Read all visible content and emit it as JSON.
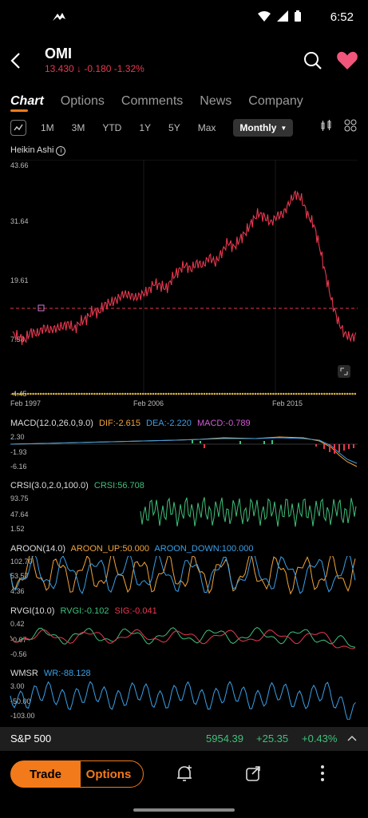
{
  "status": {
    "time": "6:52"
  },
  "header": {
    "ticker": "OMI",
    "price": "13.430",
    "change": "-0.180",
    "change_pct": "-1.32%"
  },
  "tabs": [
    "Chart",
    "Options",
    "Comments",
    "News",
    "Company"
  ],
  "ranges": [
    "1M",
    "3M",
    "YTD",
    "1Y",
    "5Y",
    "Max"
  ],
  "selected_range": "Monthly",
  "main_chart": {
    "type_label": "Heikin Ashi",
    "y_ticks": [
      "43.66",
      "31.64",
      "19.61",
      "7.58",
      "-4.45"
    ],
    "x_ticks": [
      "Feb 1997",
      "Feb 2006",
      "Feb 2015"
    ]
  },
  "macd": {
    "title": "MACD(12.0,26.0,9.0)",
    "dif": "DIF:-2.615",
    "dea": "DEA:-2.220",
    "macd": "MACD:-0.789",
    "ticks": [
      "2.30",
      "-1.93",
      "-6.16"
    ]
  },
  "crsi": {
    "title": "CRSI(3.0,2.0,100.0)",
    "val": "CRSI:56.708",
    "ticks": [
      "93.75",
      "47.64",
      "1.52"
    ]
  },
  "aroon": {
    "title": "AROON(14.0)",
    "up": "AROON_UP:50.000",
    "down": "AROON_DOWN:100.000",
    "ticks": [
      "102.70",
      "53.57",
      "4.36"
    ]
  },
  "rvgi": {
    "title": "RVGI(10.0)",
    "val": "RVGI:-0.102",
    "sig": "SIG:-0.041",
    "ticks": [
      "0.42",
      "-0.07",
      "-0.56"
    ]
  },
  "wmsr": {
    "title": "WMSR",
    "val": "WR:-88.128",
    "ticks": [
      "3.00",
      "-50.00",
      "-103.00"
    ]
  },
  "market": {
    "name": "S&P 500",
    "value": "5954.39",
    "change": "+25.35",
    "pct": "+0.43%"
  },
  "bottom": {
    "trade": "Trade",
    "options": "Options"
  },
  "colors": {
    "accent": "#f27a1a",
    "down": "#e8384f",
    "up": "#3fc07a"
  },
  "chart_data": {
    "type": "line",
    "title": "Heikin Ashi",
    "x": [
      "Feb 1997",
      "Feb 2006",
      "Feb 2015"
    ],
    "ylim": [
      -4.45,
      43.66
    ],
    "reference_price": 13.43,
    "series": [
      {
        "values": [
          8.0,
          7.2,
          6.8,
          8.5,
          8.0,
          9.3,
          8.8,
          9.2,
          9.5,
          10.1,
          9.0,
          10.5,
          11.2,
          12.8,
          12.5,
          14.2,
          14.6,
          15.3,
          16.4,
          16.2,
          15.6,
          16.3,
          17.0,
          18.6,
          18.2,
          17.5,
          19.8,
          21.3,
          22.5,
          21.6,
          23.0,
          22.4,
          24.2,
          23.0,
          25.1,
          27.3,
          26.2,
          28.0,
          29.5,
          31.8,
          33.4,
          32.6,
          31.4,
          32.8,
          33.2,
          35.6,
          37.6,
          36.4,
          33.0,
          31.0,
          26.0,
          20.0,
          14.5,
          10.5,
          8.0,
          7.2,
          7.6
        ]
      }
    ]
  }
}
